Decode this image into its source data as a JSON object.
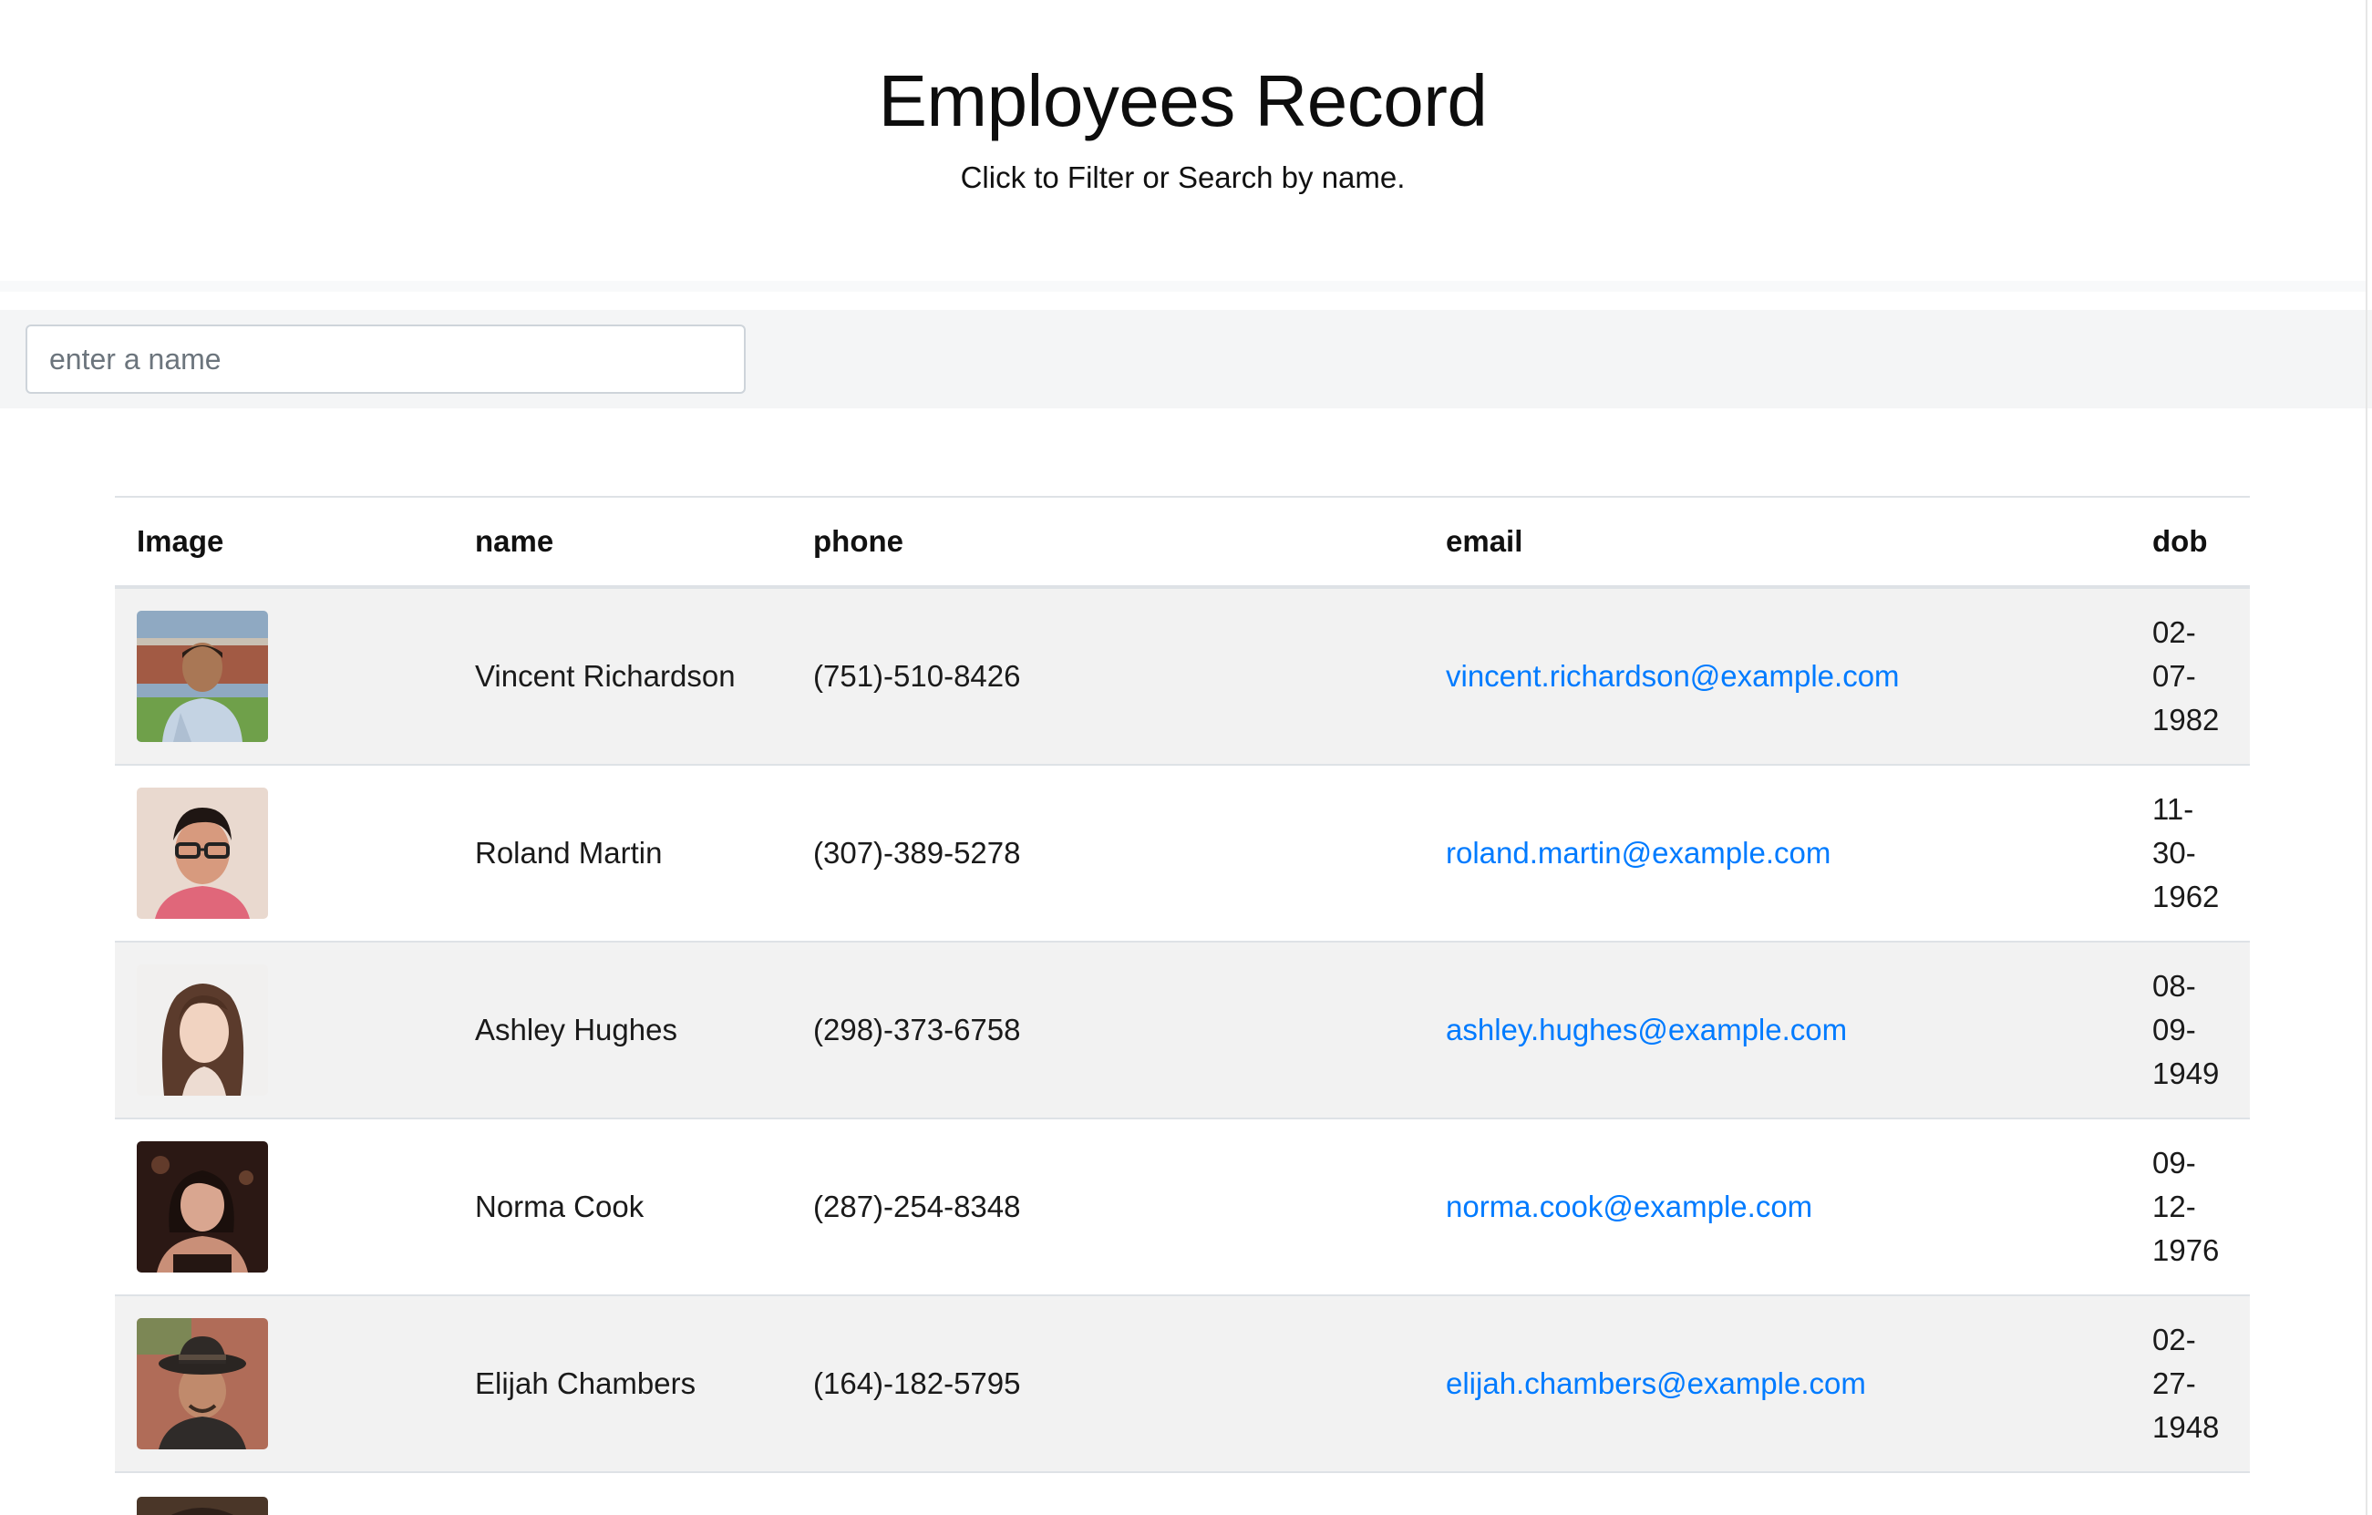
{
  "header": {
    "title": "Employees Record",
    "subtitle": "Click to Filter or Search by name."
  },
  "search": {
    "placeholder": "enter a name",
    "value": ""
  },
  "table": {
    "columns": [
      "Image",
      "name",
      "phone",
      "email",
      "dob"
    ],
    "rows": [
      {
        "name": "Vincent Richardson",
        "phone": "(751)-510-8426",
        "email": "vincent.richardson@example.com",
        "dob": "02-07-1982"
      },
      {
        "name": "Roland Martin",
        "phone": "(307)-389-5278",
        "email": "roland.martin@example.com",
        "dob": "11-30-1962"
      },
      {
        "name": "Ashley Hughes",
        "phone": "(298)-373-6758",
        "email": "ashley.hughes@example.com",
        "dob": "08-09-1949"
      },
      {
        "name": "Norma Cook",
        "phone": "(287)-254-8348",
        "email": "norma.cook@example.com",
        "dob": "09-12-1976"
      },
      {
        "name": "Elijah Chambers",
        "phone": "(164)-182-5795",
        "email": "elijah.chambers@example.com",
        "dob": "02-27-1948"
      }
    ]
  },
  "colors": {
    "link": "#007bff",
    "stripe": "#f2f2f2",
    "border": "#dee2e6",
    "search_bar_bg": "#f4f5f6"
  }
}
